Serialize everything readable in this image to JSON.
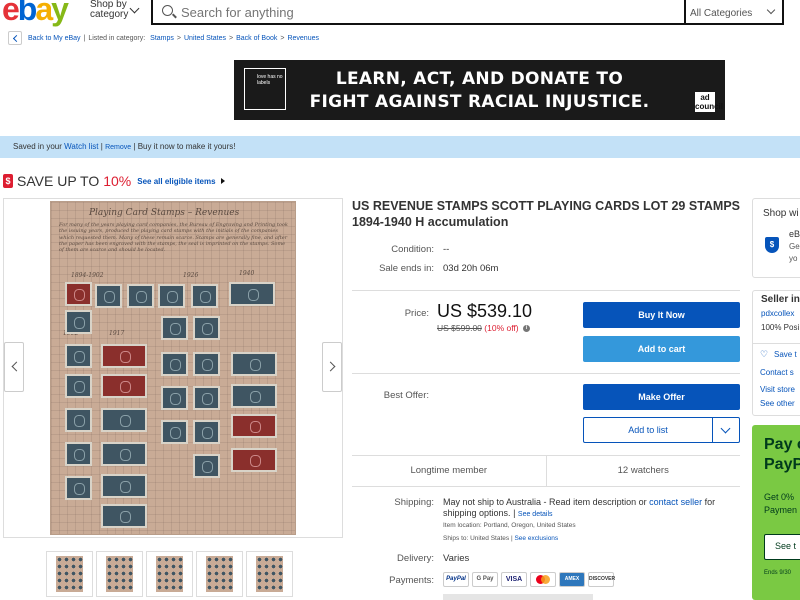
{
  "header": {
    "logo": {
      "e": "e",
      "b": "b",
      "a": "a",
      "y": "y"
    },
    "shop_by": "Shop by category",
    "search_placeholder": "Search for anything",
    "category_select": "All Categories"
  },
  "breadcrumb": {
    "back": "Back to My eBay",
    "listed_in": "Listed in category:",
    "items": [
      "Stamps",
      "United States",
      "Back of Book",
      "Revenues"
    ]
  },
  "ad": {
    "line1": "LEARN, ACT, AND DONATE TO",
    "line2": "FIGHT AGAINST RACIAL INJUSTICE.",
    "logo_text": "love has no labels",
    "badge": "ad council"
  },
  "watch_strip": {
    "prefix": "Saved in your ",
    "link": "Watch list",
    "remove": "Remove",
    "suffix": "Buy it now to make it yours!"
  },
  "promo": {
    "tag": "$",
    "text": "SAVE UP TO",
    "percent": "10%",
    "link": "See all eligible items"
  },
  "image": {
    "page_title": "Playing Card Stamps – Revenues",
    "note": "For many of the years playing card companies, the Bureau of Engraving and Printing took the issuing years, produced the playing card stamps with the initials of the companies which requested them. Many of these remain scarce. Stamps are generally fine, and after the paper has been engraved with the stamps, the seal is imprinted on the stamps. Some of them are scarce and should be located.",
    "years": [
      "1894-1902",
      "1926",
      "1940",
      "1902",
      "1917"
    ]
  },
  "listing": {
    "title": "US REVENUE STAMPS SCOTT PLAYING CARDS LOT 29 STAMPS 1894-1940 H accumulation",
    "condition_label": "Condition:",
    "condition_value": "--",
    "sale_ends_label": "Sale ends in:",
    "sale_ends_value": "03d 20h 06m",
    "price_label": "Price:",
    "price": "US $539.10",
    "was_price": "US $599.00",
    "discount": "(10% off)",
    "buy_now": "Buy It Now",
    "add_to_cart": "Add to cart",
    "best_offer_label": "Best Offer:",
    "make_offer": "Make Offer",
    "add_to_list": "Add to list",
    "longtime": "Longtime member",
    "watchers": "12 watchers",
    "shipping_label": "Shipping:",
    "shipping_text": "May not ship to Australia - Read item description or ",
    "contact_seller": "contact seller",
    "shipping_text2": " for shipping options.",
    "see_details": "See details",
    "item_location": "Item location:  Portland, Oregon, United States",
    "ships_to": "Ships to:  United States",
    "see_exclusions": "See exclusions",
    "delivery_label": "Delivery:",
    "delivery_value": "Varies",
    "payments_label": "Payments:",
    "payments": [
      "PayPal",
      "G Pay",
      "VISA",
      "",
      "AMEX",
      "DISCOVER"
    ]
  },
  "right": {
    "shop_with": "Shop wi",
    "ebay_guarantee": "eB",
    "g1": "Ge",
    "g2": "yo",
    "seller_info": "Seller in",
    "seller_name": "pdxcollex",
    "positive": "100% Posi",
    "save_seller": "Save t",
    "contact": "Contact s",
    "visit_store": "Visit store",
    "see_other": "See other",
    "pay_title1": "Pay o",
    "pay_title2": "PayP",
    "pay_sub1": "Get 0%",
    "pay_sub2": "Paymen",
    "pay_button": "See t",
    "pay_end": "Ends 9/30"
  }
}
